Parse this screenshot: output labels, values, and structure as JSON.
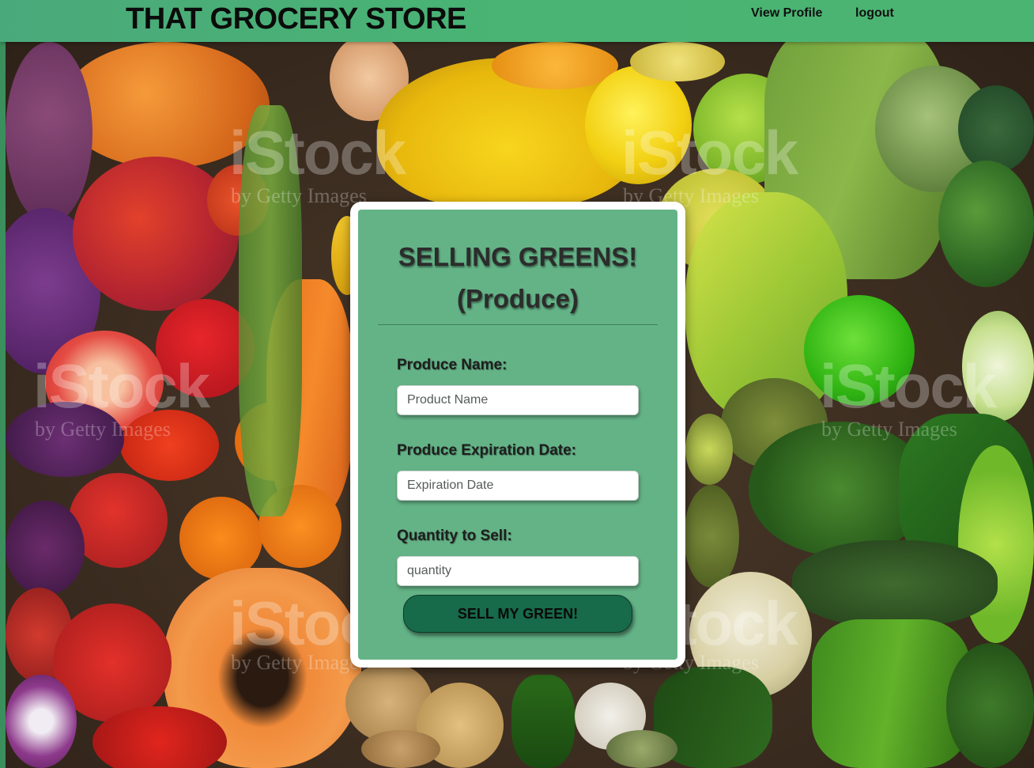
{
  "header": {
    "brand": "THAT GROCERY STORE",
    "nav": {
      "view_profile": "View Profile",
      "logout": "logout"
    }
  },
  "background": {
    "watermark_main": "iStock",
    "watermark_sub": "by Getty Images"
  },
  "form": {
    "title_line1": "SELLING GREENS!",
    "title_line2": "(Produce)",
    "fields": [
      {
        "label": "Produce Name:",
        "placeholder": "Product Name"
      },
      {
        "label": "Produce Expiration Date:",
        "placeholder": "Expiration Date"
      },
      {
        "label": "Quantity to Sell:",
        "placeholder": "quantity"
      }
    ],
    "submit_label": "SELL MY GREEN!"
  },
  "colors": {
    "header": "#4cb474",
    "card_panel": "#4ea876",
    "button": "#176a4a"
  }
}
